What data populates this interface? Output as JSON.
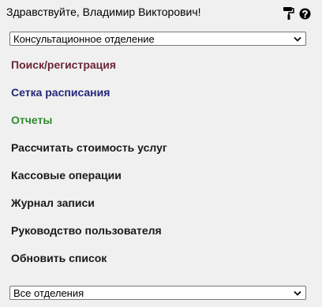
{
  "header": {
    "greeting": "Здравствуйте, Владимир Викторович!",
    "icons": [
      "paint-roller-icon",
      "help-icon"
    ]
  },
  "department_select": {
    "selected": "Консультационное отделение"
  },
  "menu": [
    {
      "label": "Поиск/регистрация",
      "color": "#6b2737"
    },
    {
      "label": "Сетка расписания",
      "color": "#23287a"
    },
    {
      "label": "Отчеты",
      "color": "#2e8b2e"
    },
    {
      "label": "Рассчитать стоимость услуг",
      "color": "#1a1a1a"
    },
    {
      "label": "Кассовые операции",
      "color": "#1a1a1a"
    },
    {
      "label": "Журнал записи",
      "color": "#1a1a1a"
    },
    {
      "label": "Руководство пользователя",
      "color": "#1a1a1a"
    },
    {
      "label": "Обновить список",
      "color": "#1a1a1a"
    }
  ],
  "filter_select": {
    "selected": "Все отделения"
  }
}
